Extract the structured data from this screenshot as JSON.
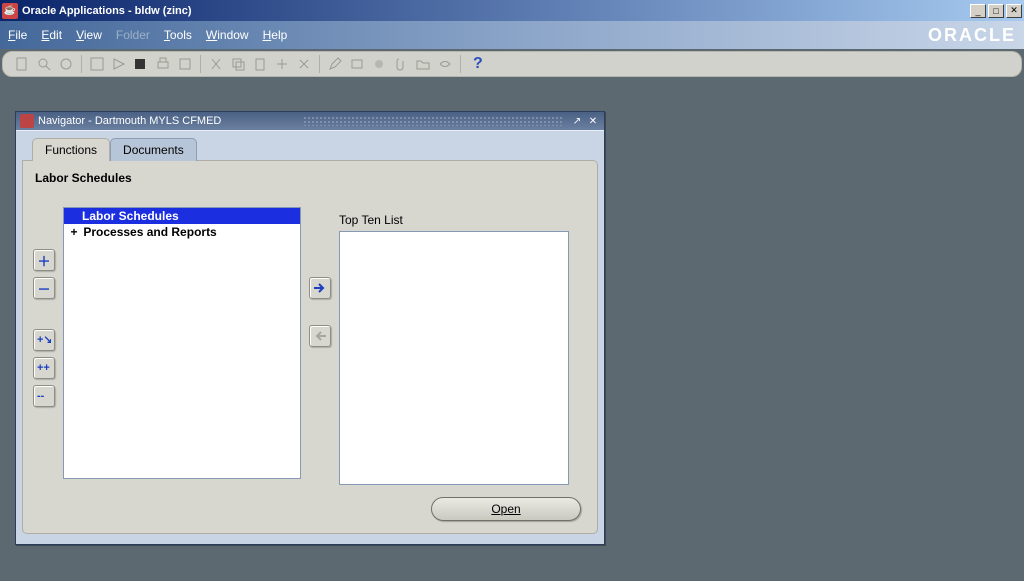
{
  "titlebar": {
    "text": "Oracle Applications - bldw (zinc)"
  },
  "menubar": {
    "items": [
      {
        "label": "File",
        "hotkey": "F",
        "enabled": true
      },
      {
        "label": "Edit",
        "hotkey": "E",
        "enabled": true
      },
      {
        "label": "View",
        "hotkey": "V",
        "enabled": true
      },
      {
        "label": "Folder",
        "hotkey": "",
        "enabled": false
      },
      {
        "label": "Tools",
        "hotkey": "T",
        "enabled": true
      },
      {
        "label": "Window",
        "hotkey": "W",
        "enabled": true
      },
      {
        "label": "Help",
        "hotkey": "H",
        "enabled": true
      }
    ],
    "logo": "ORACLE"
  },
  "navwin": {
    "title": "Navigator - Dartmouth MYLS CFMED",
    "tabs": {
      "functions": "Functions",
      "documents": "Documents"
    },
    "heading": "Labor Schedules",
    "tree": [
      {
        "label": "Labor Schedules",
        "selected": true,
        "expandable": false
      },
      {
        "label": "Processes and Reports",
        "selected": false,
        "expandable": true
      }
    ],
    "top_ten_label": "Top Ten List",
    "open_label": "Open"
  }
}
